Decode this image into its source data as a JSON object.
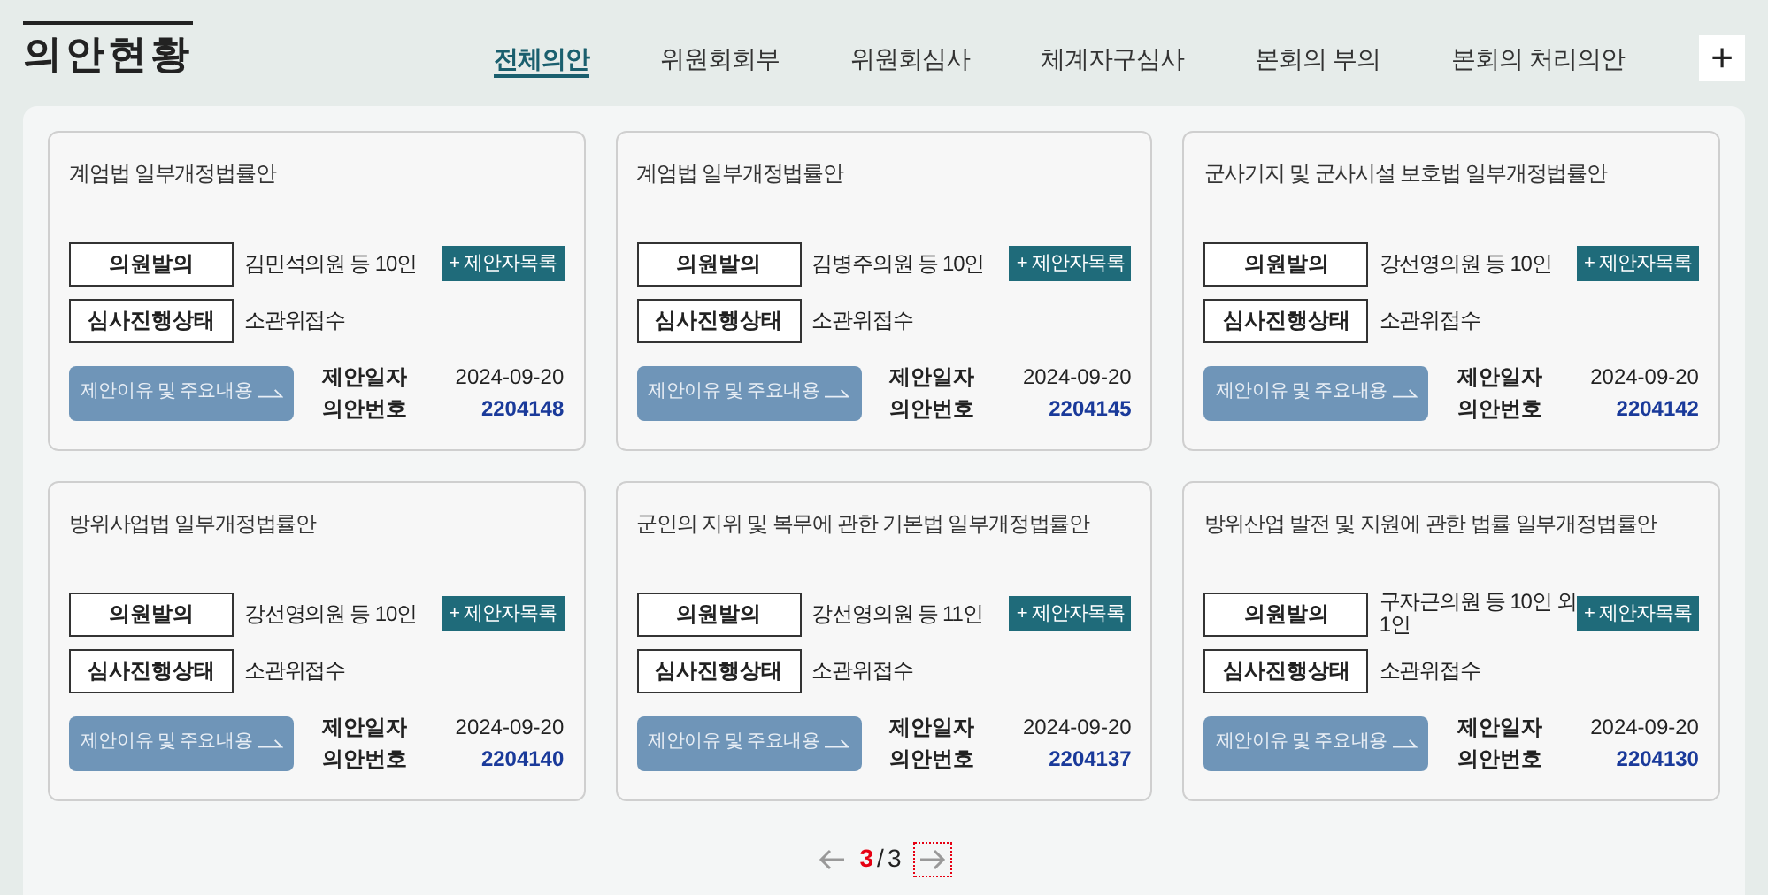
{
  "page_title": "의안현황",
  "tabs": [
    {
      "label": "전체의안",
      "selected": true
    },
    {
      "label": "위원회회부",
      "selected": false
    },
    {
      "label": "위원회심사",
      "selected": false
    },
    {
      "label": "체계자구심사",
      "selected": false
    },
    {
      "label": "본회의 부의",
      "selected": false
    },
    {
      "label": "본회의 처리의안",
      "selected": false
    }
  ],
  "more_button": "+",
  "bills": [
    {
      "title": "계엄법 일부개정법률안",
      "proposer_label": "의원발의",
      "proposer": "김민석의원 등 10인",
      "proposers_button": "+ 제안자목록",
      "status_label": "심사진행상태",
      "status": "소관위접수",
      "reason_button": "제안이유 및 주요내용",
      "date_label": "제안일자",
      "date": "2024-09-20",
      "number_label": "의안번호",
      "number": "2204148"
    },
    {
      "title": "계엄법 일부개정법률안",
      "proposer_label": "의원발의",
      "proposer": "김병주의원 등 10인",
      "proposers_button": "+ 제안자목록",
      "status_label": "심사진행상태",
      "status": "소관위접수",
      "reason_button": "제안이유 및 주요내용",
      "date_label": "제안일자",
      "date": "2024-09-20",
      "number_label": "의안번호",
      "number": "2204145"
    },
    {
      "title": "군사기지 및 군사시설 보호법 일부개정법률안",
      "proposer_label": "의원발의",
      "proposer": "강선영의원 등 10인",
      "proposers_button": "+ 제안자목록",
      "status_label": "심사진행상태",
      "status": "소관위접수",
      "reason_button": "제안이유 및 주요내용",
      "date_label": "제안일자",
      "date": "2024-09-20",
      "number_label": "의안번호",
      "number": "2204142"
    },
    {
      "title": "방위사업법 일부개정법률안",
      "proposer_label": "의원발의",
      "proposer": "강선영의원 등 10인",
      "proposers_button": "+ 제안자목록",
      "status_label": "심사진행상태",
      "status": "소관위접수",
      "reason_button": "제안이유 및 주요내용",
      "date_label": "제안일자",
      "date": "2024-09-20",
      "number_label": "의안번호",
      "number": "2204140"
    },
    {
      "title": "군인의 지위 및 복무에 관한 기본법 일부개정법률안",
      "proposer_label": "의원발의",
      "proposer": "강선영의원 등 11인",
      "proposers_button": "+ 제안자목록",
      "status_label": "심사진행상태",
      "status": "소관위접수",
      "reason_button": "제안이유 및 주요내용",
      "date_label": "제안일자",
      "date": "2024-09-20",
      "number_label": "의안번호",
      "number": "2204137"
    },
    {
      "title": "방위산업 발전 및 지원에 관한 법률 일부개정법률안",
      "proposer_label": "의원발의",
      "proposer": "구자근의원 등 10인 외 1인",
      "proposers_button": "+ 제안자목록",
      "status_label": "심사진행상태",
      "status": "소관위접수",
      "reason_button": "제안이유 및 주요내용",
      "date_label": "제안일자",
      "date": "2024-09-20",
      "number_label": "의안번호",
      "number": "2204130"
    }
  ],
  "pagination": {
    "current": "3",
    "separator": "/",
    "total": "3",
    "next_focused": true
  }
}
